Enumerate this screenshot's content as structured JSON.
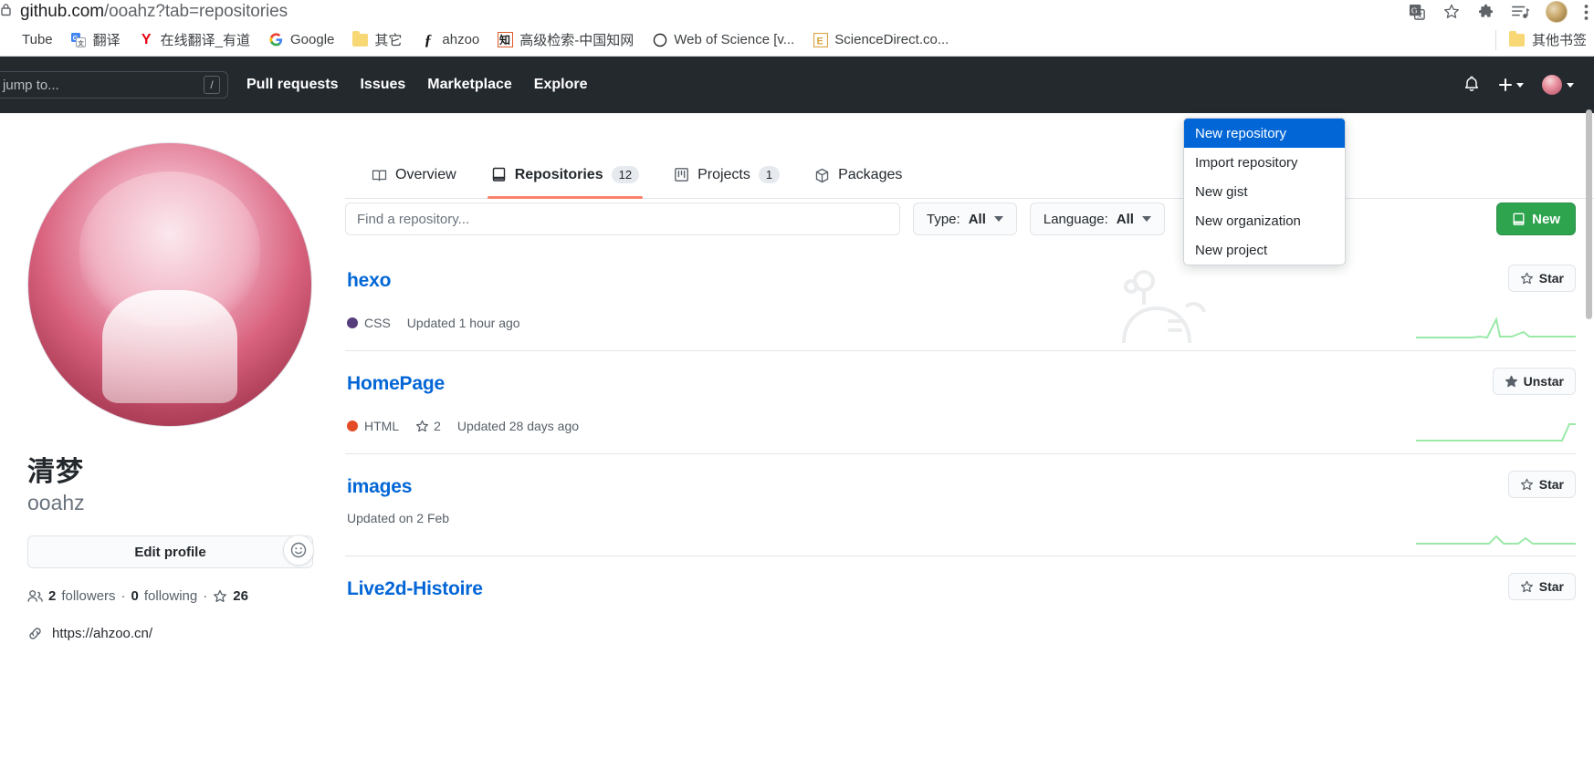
{
  "browser": {
    "url_domain": "github.com",
    "url_path": "/ooahz?tab=repositories",
    "lock_icon": "lock-icon",
    "translate_icon": "translate-icon",
    "bookmark_star_icon": "bookmark-star-icon",
    "extensions_icon": "extensions-puzzle-icon",
    "media_icon": "media-playlist-icon",
    "profile_icon": "chrome-profile-avatar",
    "menu_icon": "chrome-menu-kebab-icon",
    "bookmarks": [
      {
        "label": "Tube",
        "icon": "youtube-icon"
      },
      {
        "label": "翻译",
        "icon": "google-translate-icon"
      },
      {
        "label": "在线翻译_有道",
        "icon": "youdao-icon"
      },
      {
        "label": "Google",
        "icon": "google-icon"
      },
      {
        "label": "其它",
        "icon": "folder-icon"
      },
      {
        "label": "ahzoo",
        "icon": "ahzoo-icon"
      },
      {
        "label": "高级检索-中国知网",
        "icon": "cnki-icon"
      },
      {
        "label": "Web of Science [v...",
        "icon": "web-of-science-icon"
      },
      {
        "label": "ScienceDirect.co...",
        "icon": "sciencedirect-icon"
      }
    ],
    "other_bookmarks_label": "其他书签"
  },
  "gh_header": {
    "search_placeholder": "h or jump to...",
    "search_shortcut": "/",
    "nav": [
      {
        "label": "Pull requests"
      },
      {
        "label": "Issues"
      },
      {
        "label": "Marketplace"
      },
      {
        "label": "Explore"
      }
    ],
    "notifications_icon": "bell-icon",
    "create_new_icon": "plus-icon",
    "profile_icon": "user-avatar"
  },
  "create_menu": {
    "items": [
      {
        "label": "New repository",
        "selected": true
      },
      {
        "label": "Import repository",
        "selected": false
      },
      {
        "label": "New gist",
        "selected": false
      },
      {
        "label": "New organization",
        "selected": false
      },
      {
        "label": "New project",
        "selected": false
      }
    ]
  },
  "sidebar": {
    "avatar_name": "profile-avatar",
    "emoji_badge_icon": "set-status-emoji-icon",
    "display_name": "清梦",
    "login": "ooahz",
    "edit_profile_label": "Edit profile",
    "followers_icon": "people-icon",
    "followers_count": "2",
    "followers_label": "followers",
    "following_count": "0",
    "following_label": "following",
    "star_icon": "star-icon",
    "stars_count": "26",
    "link_icon": "link-icon",
    "website": "https://ahzoo.cn/"
  },
  "tabs": [
    {
      "label": "Overview",
      "icon": "book-icon",
      "count": "",
      "active": false
    },
    {
      "label": "Repositories",
      "icon": "repo-icon",
      "count": "12",
      "active": true
    },
    {
      "label": "Projects",
      "icon": "project-board-icon",
      "count": "1",
      "active": false
    },
    {
      "label": "Packages",
      "icon": "package-icon",
      "count": "",
      "active": false
    }
  ],
  "filters": {
    "find_placeholder": "Find a repository...",
    "type_label": "Type:",
    "type_value": "All",
    "language_label": "Language:",
    "language_value": "All",
    "new_button_label": "New",
    "new_button_icon": "repo-icon",
    "accent_green": "#2ea44f"
  },
  "repos": [
    {
      "name": "hexo",
      "language": "CSS",
      "lang_color": "#563d7c",
      "stars": "",
      "updated": "Updated 1 hour ago",
      "star_label": "Star",
      "starred": false,
      "spark": [
        2,
        2,
        2,
        2,
        3,
        2,
        2,
        2,
        2,
        9,
        3,
        2,
        2,
        4,
        2,
        2,
        2,
        2,
        2,
        2,
        2,
        2,
        2,
        2
      ]
    },
    {
      "name": "HomePage",
      "language": "HTML",
      "lang_color": "#e34c26",
      "stars": "2",
      "updated": "Updated 28 days ago",
      "star_label": "Unstar",
      "starred": true,
      "spark": [
        2,
        2,
        2,
        2,
        2,
        2,
        2,
        2,
        2,
        2,
        2,
        2,
        2,
        2,
        2,
        2,
        2,
        2,
        2,
        2,
        2,
        2,
        2,
        8
      ]
    },
    {
      "name": "images",
      "language": "",
      "lang_color": "",
      "stars": "",
      "updated": "Updated on 2 Feb",
      "star_label": "Star",
      "starred": false,
      "spark": [
        2,
        2,
        2,
        2,
        2,
        2,
        2,
        2,
        4,
        2,
        2,
        2,
        5,
        2,
        3,
        2,
        2,
        2,
        2,
        2,
        2,
        2,
        2,
        2
      ]
    },
    {
      "name": "Live2d-Histoire",
      "language": "",
      "lang_color": "",
      "stars": "",
      "updated": "",
      "star_label": "Star",
      "starred": false,
      "spark": []
    }
  ],
  "colors": {
    "header_bg": "#24292e",
    "link_blue": "#0366d6",
    "tab_accent": "#f9826c",
    "menu_highlight": "#0366d6"
  }
}
